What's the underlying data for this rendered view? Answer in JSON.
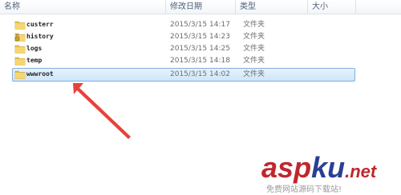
{
  "columns": {
    "name": "名称",
    "date": "修改日期",
    "type": "类型",
    "size": "大小"
  },
  "folders": [
    {
      "name": "custerr",
      "date": "2015/3/15 14:17",
      "type": "文件夹",
      "icon": "folder-icon",
      "selected": false
    },
    {
      "name": "history",
      "date": "2015/3/15 14:23",
      "type": "文件夹",
      "icon": "locked-folder-icon",
      "selected": false
    },
    {
      "name": "logs",
      "date": "2015/3/15 14:25",
      "type": "文件夹",
      "icon": "folder-icon",
      "selected": false
    },
    {
      "name": "temp",
      "date": "2015/3/15 14:18",
      "type": "文件夹",
      "icon": "folder-icon",
      "selected": false
    },
    {
      "name": "wwwroot",
      "date": "2015/3/15 14:02",
      "type": "文件夹",
      "icon": "folder-icon",
      "selected": true
    }
  ],
  "annotation": {
    "icon": "red-arrow-icon",
    "color": "#e8413a"
  },
  "watermark": {
    "brand_a": "a",
    "brand_s": "s",
    "brand_p": "p",
    "brand_k": "k",
    "brand_u": "u",
    "brand_tld": ".net",
    "subtitle": "免费网站源码下载站!"
  }
}
